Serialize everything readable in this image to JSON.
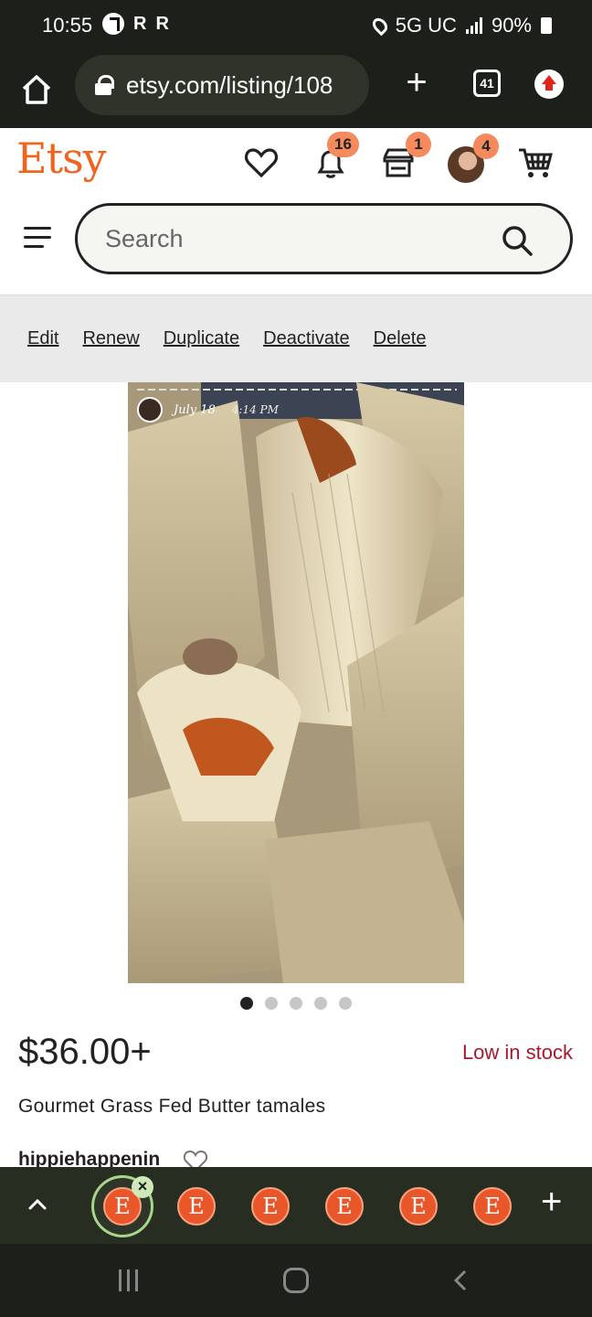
{
  "status_bar": {
    "time": "10:55",
    "notif_letters": [
      "R",
      "R"
    ],
    "network": "5G UC",
    "battery": "90%"
  },
  "browser": {
    "url": "etsy.com/listing/108",
    "tab_count": "41"
  },
  "header": {
    "logo": "Etsy",
    "notifications_count": "16",
    "shop_count": "1",
    "account_count": "4"
  },
  "search": {
    "placeholder": "Search"
  },
  "actions": {
    "edit": "Edit",
    "renew": "Renew",
    "duplicate": "Duplicate",
    "deactivate": "Deactivate",
    "delete": "Delete"
  },
  "photo": {
    "date": "July 18",
    "time": "4:14 PM",
    "dot_count": 5,
    "active_dot": 1
  },
  "listing": {
    "price": "$36.00+",
    "stock": "Low in stock",
    "title": "Gourmet Grass Fed Butter tamales",
    "shop": "hippiehappenin"
  },
  "tab_strip": {
    "tab_letter": "E",
    "tab_count": 6
  },
  "colors": {
    "etsy_orange": "#f1641e",
    "badge": "#f58a5e",
    "stock_red": "#a61a2e",
    "dark_bar": "#1d1f1a"
  }
}
